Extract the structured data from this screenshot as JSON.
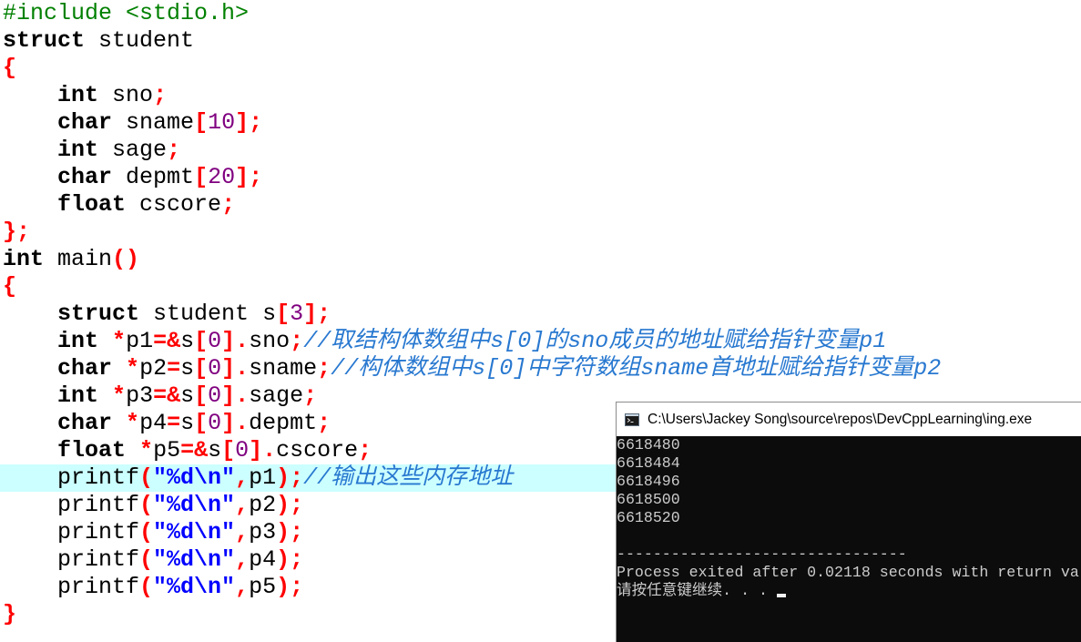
{
  "colors": {
    "preprocessor": "#008000",
    "keyword": "#000000",
    "identifier": "#000000",
    "symbol": "#ff0000",
    "number": "#800080",
    "string": "#0000ff",
    "comment": "#2878d0",
    "current_line_bg": "#ccffff",
    "console_bg": "#0c0c0c",
    "console_text": "#cccccc",
    "console_cursor": "#f2f2f2"
  },
  "editor": {
    "lines": [
      {
        "tokens": [
          {
            "pp": "#include <stdio.h>"
          }
        ]
      },
      {
        "tokens": [
          {
            "kw": "struct"
          },
          {
            "sp": " "
          },
          {
            "id": "student"
          }
        ]
      },
      {
        "tokens": [
          {
            "op": "{"
          }
        ]
      },
      {
        "tokens": [
          {
            "sp": "    "
          },
          {
            "kw": "int"
          },
          {
            "sp": " "
          },
          {
            "id": "sno"
          },
          {
            "op": ";"
          }
        ]
      },
      {
        "tokens": [
          {
            "sp": "    "
          },
          {
            "kw": "char"
          },
          {
            "sp": " "
          },
          {
            "id": "sname"
          },
          {
            "op": "["
          },
          {
            "num": "10"
          },
          {
            "op": "];"
          }
        ]
      },
      {
        "tokens": [
          {
            "sp": "    "
          },
          {
            "kw": "int"
          },
          {
            "sp": " "
          },
          {
            "id": "sage"
          },
          {
            "op": ";"
          }
        ]
      },
      {
        "tokens": [
          {
            "sp": "    "
          },
          {
            "kw": "char"
          },
          {
            "sp": " "
          },
          {
            "id": "depmt"
          },
          {
            "op": "["
          },
          {
            "num": "20"
          },
          {
            "op": "];"
          }
        ]
      },
      {
        "tokens": [
          {
            "sp": "    "
          },
          {
            "kw": "float"
          },
          {
            "sp": " "
          },
          {
            "id": "cscore"
          },
          {
            "op": ";"
          }
        ]
      },
      {
        "tokens": [
          {
            "op": "};"
          }
        ]
      },
      {
        "tokens": [
          {
            "kw": "int"
          },
          {
            "sp": " "
          },
          {
            "id": "main"
          },
          {
            "op": "()"
          }
        ]
      },
      {
        "tokens": [
          {
            "op": "{"
          }
        ]
      },
      {
        "tokens": [
          {
            "sp": "    "
          },
          {
            "kw": "struct"
          },
          {
            "sp": " "
          },
          {
            "id": "student"
          },
          {
            "sp": " "
          },
          {
            "id": "s"
          },
          {
            "op": "["
          },
          {
            "num": "3"
          },
          {
            "op": "];"
          }
        ]
      },
      {
        "tokens": [
          {
            "sp": "    "
          },
          {
            "kw": "int"
          },
          {
            "sp": " "
          },
          {
            "op": "*"
          },
          {
            "id": "p1"
          },
          {
            "op": "=&"
          },
          {
            "id": "s"
          },
          {
            "op": "["
          },
          {
            "num": "0"
          },
          {
            "op": "]."
          },
          {
            "id": "sno"
          },
          {
            "op": ";"
          },
          {
            "cm": "//取结构体数组中s[0]的sno成员的地址赋给指针变量p1"
          }
        ]
      },
      {
        "tokens": [
          {
            "sp": "    "
          },
          {
            "kw": "char"
          },
          {
            "sp": " "
          },
          {
            "op": "*"
          },
          {
            "id": "p2"
          },
          {
            "op": "="
          },
          {
            "id": "s"
          },
          {
            "op": "["
          },
          {
            "num": "0"
          },
          {
            "op": "]."
          },
          {
            "id": "sname"
          },
          {
            "op": ";"
          },
          {
            "cm": "//构体数组中s[0]中字符数组sname首地址赋给指针变量p2"
          }
        ]
      },
      {
        "tokens": [
          {
            "sp": "    "
          },
          {
            "kw": "int"
          },
          {
            "sp": " "
          },
          {
            "op": "*"
          },
          {
            "id": "p3"
          },
          {
            "op": "=&"
          },
          {
            "id": "s"
          },
          {
            "op": "["
          },
          {
            "num": "0"
          },
          {
            "op": "]."
          },
          {
            "id": "sage"
          },
          {
            "op": ";"
          }
        ]
      },
      {
        "tokens": [
          {
            "sp": "    "
          },
          {
            "kw": "char"
          },
          {
            "sp": " "
          },
          {
            "op": "*"
          },
          {
            "id": "p4"
          },
          {
            "op": "="
          },
          {
            "id": "s"
          },
          {
            "op": "["
          },
          {
            "num": "0"
          },
          {
            "op": "]."
          },
          {
            "id": "depmt"
          },
          {
            "op": ";"
          }
        ]
      },
      {
        "tokens": [
          {
            "sp": "    "
          },
          {
            "kw": "float"
          },
          {
            "sp": " "
          },
          {
            "op": "*"
          },
          {
            "id": "p5"
          },
          {
            "op": "=&"
          },
          {
            "id": "s"
          },
          {
            "op": "["
          },
          {
            "num": "0"
          },
          {
            "op": "]."
          },
          {
            "id": "cscore"
          },
          {
            "op": ";"
          }
        ]
      },
      {
        "current": true,
        "tokens": [
          {
            "sp": "    "
          },
          {
            "id": "printf"
          },
          {
            "op": "("
          },
          {
            "str": "\"%d\\n\""
          },
          {
            "op": ","
          },
          {
            "id": "p1"
          },
          {
            "op": ");"
          },
          {
            "cm": "//输出这些内存地址"
          }
        ]
      },
      {
        "tokens": [
          {
            "sp": "    "
          },
          {
            "id": "printf"
          },
          {
            "op": "("
          },
          {
            "str": "\"%d\\n\""
          },
          {
            "op": ","
          },
          {
            "id": "p2"
          },
          {
            "op": ");"
          }
        ]
      },
      {
        "tokens": [
          {
            "sp": "    "
          },
          {
            "id": "printf"
          },
          {
            "op": "("
          },
          {
            "str": "\"%d\\n\""
          },
          {
            "op": ","
          },
          {
            "id": "p3"
          },
          {
            "op": ");"
          }
        ]
      },
      {
        "tokens": [
          {
            "sp": "    "
          },
          {
            "id": "printf"
          },
          {
            "op": "("
          },
          {
            "str": "\"%d\\n\""
          },
          {
            "op": ","
          },
          {
            "id": "p4"
          },
          {
            "op": ");"
          }
        ]
      },
      {
        "tokens": [
          {
            "sp": "    "
          },
          {
            "id": "printf"
          },
          {
            "op": "("
          },
          {
            "str": "\"%d\\n\""
          },
          {
            "op": ","
          },
          {
            "id": "p5"
          },
          {
            "op": ");"
          }
        ]
      },
      {
        "tokens": [
          {
            "op": "}"
          }
        ]
      }
    ]
  },
  "console": {
    "icon": "console-app-icon",
    "title": "C:\\Users\\Jackey Song\\source\\repos\\DevCppLearning\\ing.exe",
    "output": [
      "6618480",
      "6618484",
      "6618496",
      "6618500",
      "6618520",
      "",
      "--------------------------------",
      "Process exited after 0.02118 seconds with return va",
      "请按任意键继续. . . "
    ]
  }
}
